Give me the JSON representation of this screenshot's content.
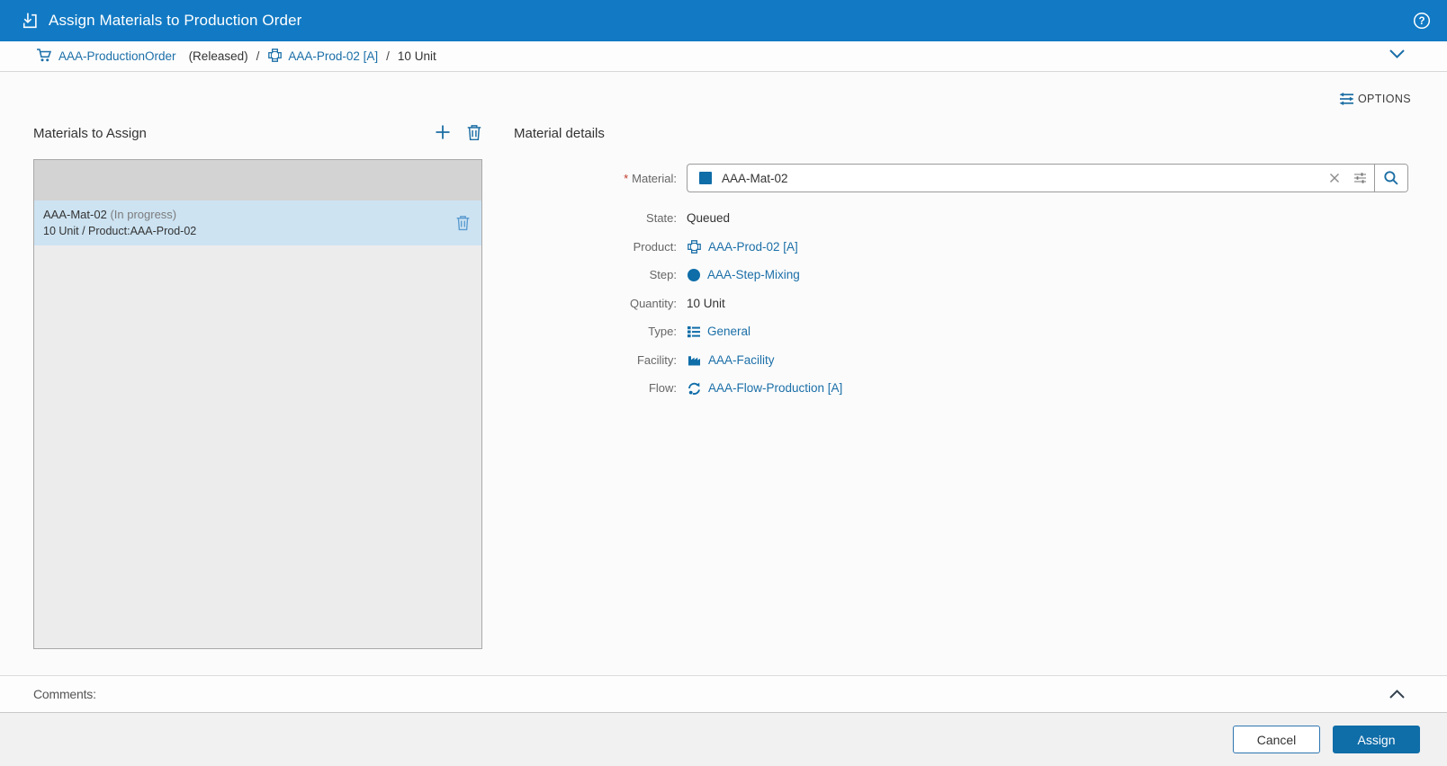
{
  "titlebar": {
    "title": "Assign Materials to Production Order"
  },
  "breadcrumb": {
    "order_label": "AAA-ProductionOrder",
    "order_state": "(Released)",
    "separator": "/",
    "product_label": "AAA-Prod-02 [A]",
    "quantity": "10 Unit"
  },
  "toolbar": {
    "options_label": "OPTIONS"
  },
  "materials_panel": {
    "title": "Materials to Assign",
    "selected_item": {
      "name": "AAA-Mat-02",
      "status": "(In progress)",
      "detail": "10 Unit / Product:AAA-Prod-02"
    }
  },
  "details": {
    "title": "Material details",
    "material_field": {
      "required_marker": "*",
      "label": "Material:",
      "value": "AAA-Mat-02"
    },
    "fields": [
      {
        "label": "State:",
        "value": "Queued"
      },
      {
        "label": "Product:",
        "value": "AAA-Prod-02 [A]"
      },
      {
        "label": "Step:",
        "value": "AAA-Step-Mixing"
      },
      {
        "label": "Quantity:",
        "value": "10 Unit"
      },
      {
        "label": "Type:",
        "value": "General"
      },
      {
        "label": "Facility:",
        "value": "AAA-Facility"
      },
      {
        "label": "Flow:",
        "value": "AAA-Flow-Production [A]"
      }
    ]
  },
  "comments": {
    "label": "Comments:"
  },
  "footer": {
    "cancel_label": "Cancel",
    "assign_label": "Assign"
  },
  "colors": {
    "header_blue": "#127ac4",
    "link_blue": "#1b6fa8",
    "icon_blue": "#1c6ea4",
    "accent_blue": "#0f6da8",
    "selected_row": "#cde3f2"
  }
}
